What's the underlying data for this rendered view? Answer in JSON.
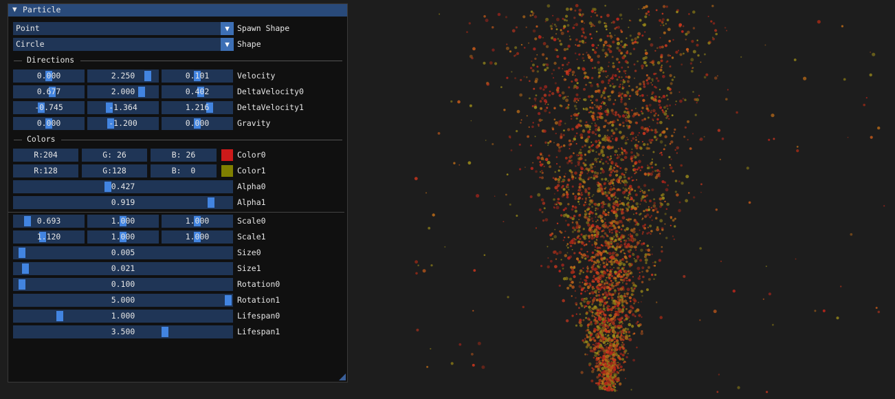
{
  "panel": {
    "title": "Particle",
    "spawn_shape": {
      "value": "Point",
      "label": "Spawn Shape"
    },
    "shape": {
      "value": "Circle",
      "label": "Shape"
    },
    "directions_header": "Directions",
    "colors_header": "Colors",
    "velocity": {
      "label": "Velocity",
      "values": [
        "0.000",
        "2.250",
        "0.101"
      ],
      "levels": [
        0.5,
        0.9,
        0.5
      ]
    },
    "delta_velocity0": {
      "label": "DeltaVelocity0",
      "values": [
        "0.677",
        "2.000",
        "0.402"
      ],
      "levels": [
        0.55,
        0.8,
        0.55
      ]
    },
    "delta_velocity1": {
      "label": "DeltaVelocity1",
      "values": [
        "-0.745",
        "-1.364",
        "1.216"
      ],
      "levels": [
        0.38,
        0.28,
        0.7
      ]
    },
    "gravity": {
      "label": "Gravity",
      "values": [
        "0.000",
        "-1.200",
        "0.000"
      ],
      "levels": [
        0.5,
        0.3,
        0.5
      ]
    },
    "color0": {
      "label": "Color0",
      "r": "R:204",
      "g": "G: 26",
      "b": "B: 26",
      "swatch": "#cc1a1a"
    },
    "color1": {
      "label": "Color1",
      "r": "R:128",
      "g": "G:128",
      "b": "B:  0",
      "swatch": "#808000"
    },
    "alpha0": {
      "label": "Alpha0",
      "value": "0.427",
      "level": 0.427
    },
    "alpha1": {
      "label": "Alpha1",
      "value": "0.919",
      "level": 0.919
    },
    "scale0": {
      "label": "Scale0",
      "values": [
        "0.693",
        "1.000",
        "1.000"
      ],
      "levels": [
        0.15,
        0.5,
        0.5
      ]
    },
    "scale1": {
      "label": "Scale1",
      "values": [
        "1.120",
        "1.000",
        "1.000"
      ],
      "levels": [
        0.4,
        0.5,
        0.5
      ]
    },
    "size0": {
      "label": "Size0",
      "value": "0.005",
      "level": 0.02
    },
    "size1": {
      "label": "Size1",
      "value": "0.021",
      "level": 0.035
    },
    "rotation0": {
      "label": "Rotation0",
      "value": "0.100",
      "level": 0.02
    },
    "rotation1": {
      "label": "Rotation1",
      "value": "5.000",
      "level": 1.0
    },
    "lifespan0": {
      "label": "Lifespan0",
      "value": "1.000",
      "level": 0.2
    },
    "lifespan1": {
      "label": "Lifespan1",
      "value": "3.500",
      "level": 0.7
    }
  },
  "colors": {
    "frame_bg": "#1f3556",
    "grab": "#4284e0",
    "title_bg": "#294a7a",
    "scene_bg": "#1d1d1d"
  }
}
